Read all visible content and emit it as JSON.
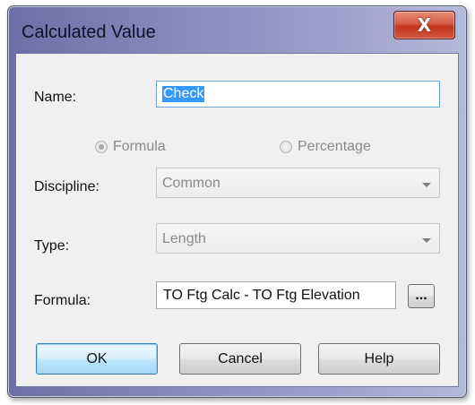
{
  "dialog": {
    "title": "Calculated Value",
    "close_glyph": "X",
    "name_label": "Name:",
    "name_value": "Check",
    "radio_formula_label": "Formula",
    "radio_percentage_label": "Percentage",
    "radio_selected": "formula",
    "discipline_label": "Discipline:",
    "discipline_value": "Common",
    "type_label": "Type:",
    "type_value": "Length",
    "formula_label": "Formula:",
    "formula_value": "TO Ftg Calc - TO Ftg Elevation",
    "browse_label": "...",
    "ok_label": "OK",
    "cancel_label": "Cancel",
    "help_label": "Help"
  },
  "icons": {
    "close": "close-icon",
    "dropdown": "chevron-down-icon"
  },
  "colors": {
    "title_gradient_start": "#6f6da7",
    "close_button": "#c2351e",
    "selection": "#3399ff",
    "default_button": "#bee6fd"
  }
}
